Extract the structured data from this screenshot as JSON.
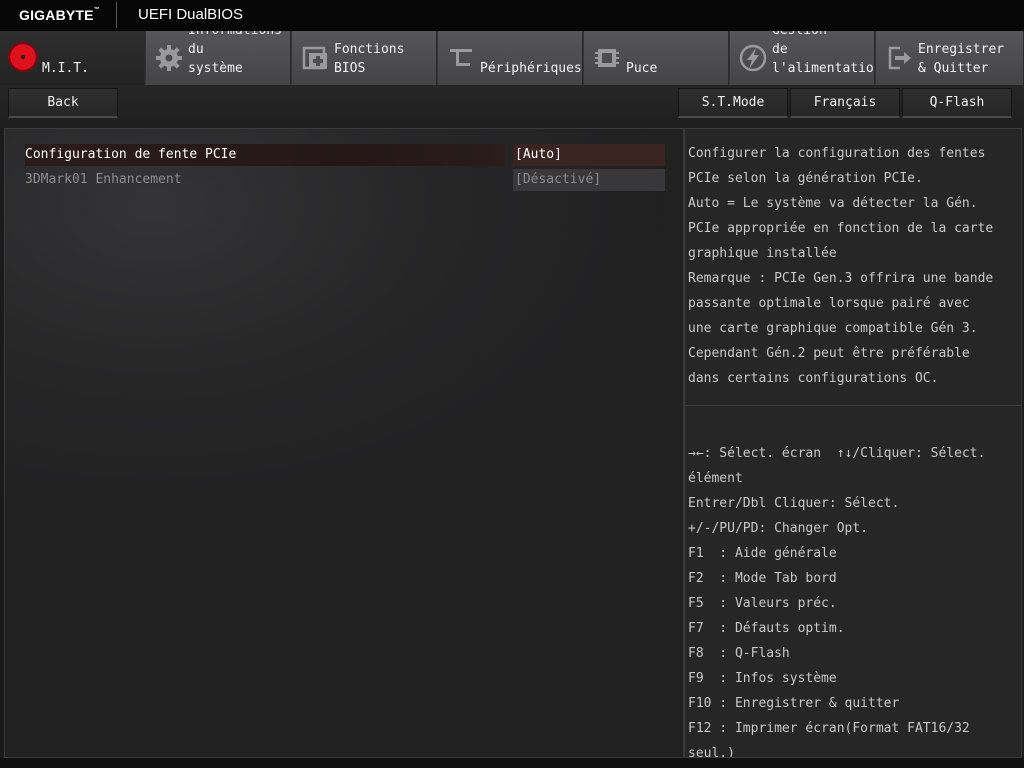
{
  "header": {
    "brand": "GIGABYTE",
    "brand_tm": "™",
    "product": "UEFI DualBIOS"
  },
  "tabs": [
    {
      "id": "mit",
      "label": "M.I.T.",
      "icon": "mit-dial-icon",
      "active": true
    },
    {
      "id": "system-info",
      "label": "Informations\ndu\nsystème",
      "icon": "gear-icon",
      "active": false
    },
    {
      "id": "bios-features",
      "label": "Fonctions\nBIOS",
      "icon": "bios-chip-icon",
      "active": false
    },
    {
      "id": "peripherals",
      "label": "Périphériques",
      "icon": "peripherals-icon",
      "active": false
    },
    {
      "id": "chipset",
      "label": "Puce",
      "icon": "chipset-icon",
      "active": false
    },
    {
      "id": "power",
      "label": "Gestion\nde\nl'alimentation",
      "icon": "power-bolt-icon",
      "active": false
    },
    {
      "id": "save-exit",
      "label": "Enregistrer\n& Quitter",
      "icon": "exit-door-icon",
      "active": false
    }
  ],
  "toolbar": {
    "back": "Back",
    "st_mode": "S.T.Mode",
    "language": "Français",
    "qflash": "Q-Flash"
  },
  "settings": [
    {
      "label": "Configuration de fente PCIe",
      "value": "[Auto]",
      "selected": true,
      "enabled": true
    },
    {
      "label": "3DMark01 Enhancement",
      "value": "[Désactivé]",
      "selected": false,
      "enabled": false
    }
  ],
  "help_text": [
    "Configurer la configuration des fentes",
    "PCIe selon la génération PCIe.",
    "Auto = Le système va détecter la Gén.",
    "PCIe appropriée en fonction de la carte",
    "graphique installée",
    "Remarque : PCIe Gen.3 offrira une bande",
    "passante optimale lorsque pairé avec",
    "une carte graphique compatible Gén 3.",
    "Cependant Gén.2 peut être préférable",
    "dans certains configurations OC."
  ],
  "key_help": [
    "→←: Sélect. écran  ↑↓/Cliquer: Sélect.",
    "élément",
    "Entrer/Dbl Cliquer: Sélect.",
    "+/-/PU/PD: Changer Opt.",
    "F1  : Aide générale",
    "F2  : Mode Tab bord",
    "F5  : Valeurs préc.",
    "F7  : Défauts optim.",
    "F8  : Q-Flash",
    "F9  : Infos système",
    "F10 : Enregistrer & quitter",
    "F12 : Imprimer écran(Format FAT16/32",
    "seul.)"
  ],
  "colors": {
    "accent_red": "#e0101c",
    "selected_row": "#3a2421"
  }
}
